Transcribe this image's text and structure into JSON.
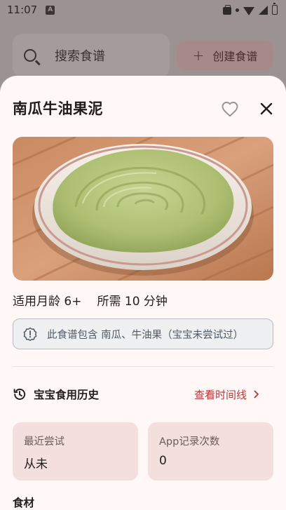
{
  "status_bar": {
    "time": "11:07",
    "notification_letter": "A",
    "icons": [
      "work-bag-icon",
      "dot-icon",
      "wifi-icon",
      "signal-icon",
      "battery-icon"
    ]
  },
  "background": {
    "search_placeholder": "搜索食谱",
    "create_button_label": "创建食谱"
  },
  "recipe": {
    "title": "南瓜牛油果泥",
    "favorited": false,
    "age_label": "适用月龄 6+",
    "time_label": "所需 10 分钟",
    "allergen_notice": "此食谱包含 南瓜、牛油果（宝宝未尝试过）"
  },
  "history": {
    "title": "宝宝食用历史",
    "timeline_link": "查看时间线",
    "last_tried_label": "最近尝试",
    "last_tried_value": "从未",
    "app_count_label": "App记录次数",
    "app_count_value": "0"
  },
  "ingredients": {
    "title": "食材"
  },
  "colors": {
    "sheet_bg": "#fff8f7",
    "accent": "#b03a3c",
    "stat_card_bg": "#f3dfdd",
    "info_border": "#b9bcc0"
  }
}
